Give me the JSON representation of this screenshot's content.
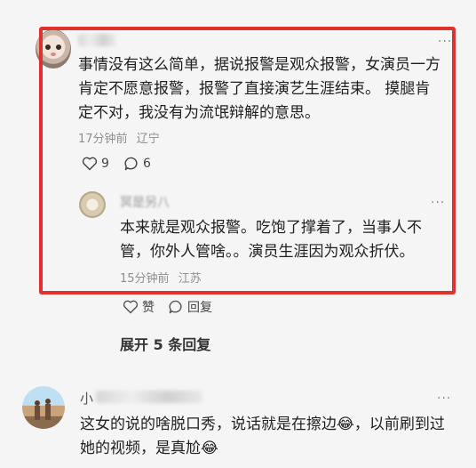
{
  "comment1": {
    "text": "事情没有这么简单，据说报警是观众报警，女演员一方肯定不愿意报警，报警了直接演艺生涯结束。 摸腿肯定不对，我没有为流氓辩解的意思。",
    "time": "17分钟前",
    "location": "辽宁",
    "likes": "9",
    "replies_count": "6"
  },
  "reply": {
    "username": "冥是另八",
    "text": "本来就是观众报警。吃饱了撑着了，当事人不管，你外人管啥。。演员生涯因为观众折伏。",
    "time": "15分钟前",
    "location": "江苏",
    "like_label": "赞",
    "reply_label": "回复"
  },
  "expand": {
    "label": "展开 5 条回复"
  },
  "comment2": {
    "username": "小",
    "text": "这女的说的啥脱口秀，说话就是在擦边😂，以前刷到过她的视频，是真尬😂"
  },
  "colors": {
    "highlight": "#e0312d",
    "background": "#f5f5f5",
    "meta": "#8e8e8e"
  }
}
